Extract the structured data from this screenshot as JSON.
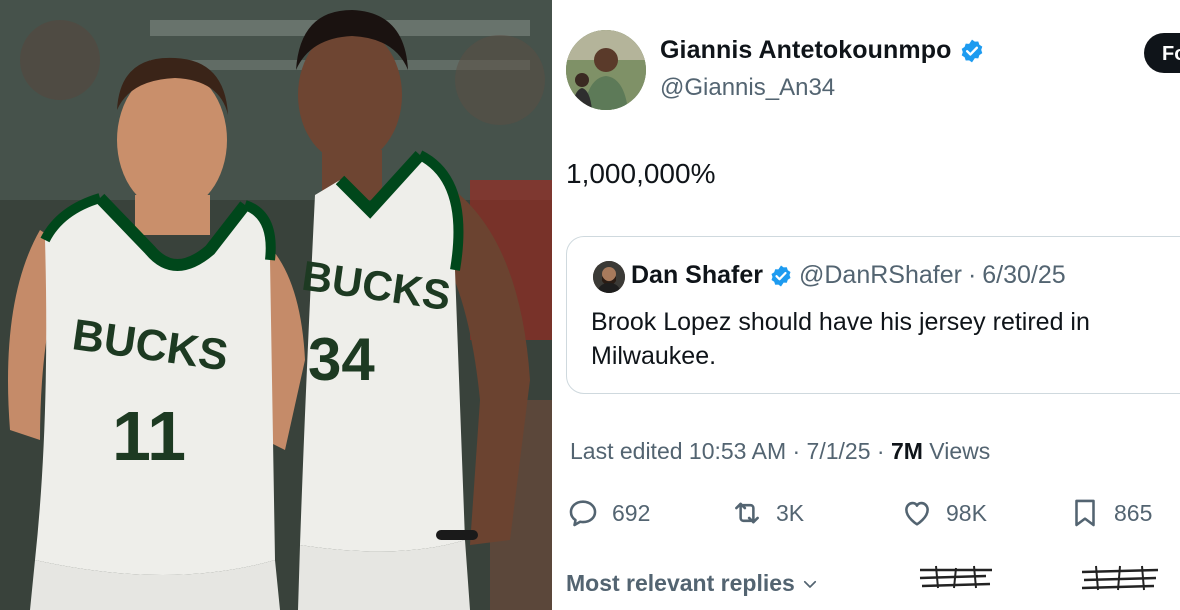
{
  "photo": {
    "left_player": {
      "team": "BUCKS",
      "number": "11"
    },
    "right_player": {
      "team": "BUCKS",
      "number": "34"
    }
  },
  "tweet": {
    "author": {
      "display_name": "Giannis Antetokounmpo",
      "handle": "@Giannis_An34",
      "verified": true
    },
    "follow_label": "Fo",
    "text": "1,000,000%",
    "quoted": {
      "display_name": "Dan Shafer",
      "handle": "@DanRShafer",
      "date": "6/30/25",
      "text": "Brook Lopez should have his jersey retired in Milwaukee."
    },
    "meta": {
      "edited_label": "Last edited 10:53 AM · 7/1/25",
      "views_count": "7M",
      "views_label": "Views"
    },
    "stats": {
      "replies": "692",
      "reposts": "3K",
      "likes": "98K",
      "bookmarks": "865"
    },
    "replies_sort_label": "Most relevant replies"
  },
  "colors": {
    "verified": "#1d9bf0",
    "secondary_text": "#536471",
    "primary_text": "#0f1419",
    "jersey": "#eeeeea",
    "jersey_trim": "#00471b"
  }
}
